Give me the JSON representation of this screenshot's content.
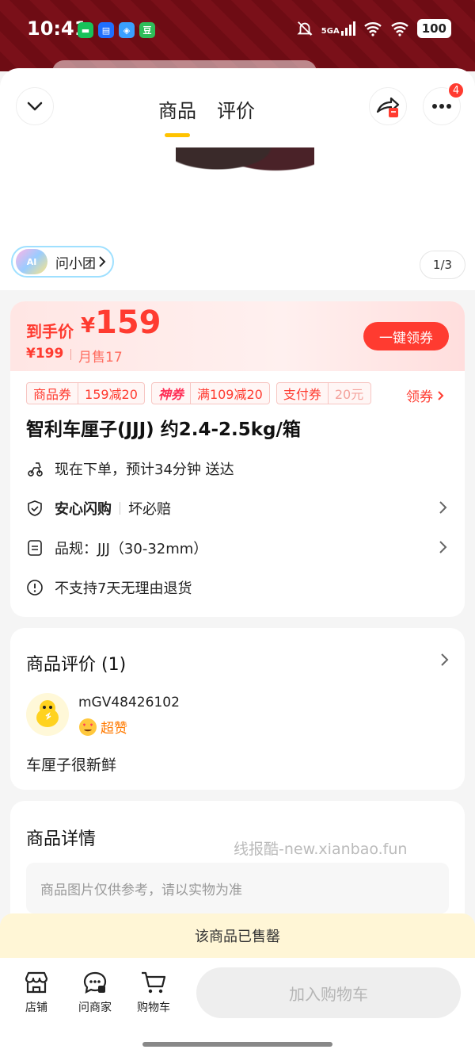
{
  "status_bar": {
    "time": "10:41",
    "network": "5GA",
    "battery": "100",
    "app_icons": [
      {
        "name": "wechat-icon",
        "color": "#17c25a",
        "glyph": ""
      },
      {
        "name": "message-icon",
        "color": "#1f6fff",
        "glyph": ""
      },
      {
        "name": "map-icon",
        "color": "#3aa0ff",
        "glyph": ""
      },
      {
        "name": "douban-icon",
        "color": "#2ebd59",
        "glyph": "豆"
      }
    ]
  },
  "header": {
    "tabs": [
      "商品",
      "评价"
    ],
    "active_tab": "商品",
    "more_badge": "4"
  },
  "hero": {
    "ai_label": "问小团",
    "ai_badge": "AI",
    "page_indicator": "1/3"
  },
  "price": {
    "label": "到手价",
    "currency": "¥",
    "value": "159",
    "original": "¥199",
    "monthly_sales": "月售17",
    "claim_button": "一键领券"
  },
  "coupons": [
    {
      "tag": "商品券",
      "value": "159减20"
    },
    {
      "tag": "神券",
      "value": "满109减20"
    },
    {
      "tag": "支付券",
      "value": "20元"
    }
  ],
  "coupon_more": "领券",
  "product": {
    "title": "智利车厘子(JJJ) 约2.4-2.5kg/箱",
    "delivery": "现在下单，预计34分钟 送达",
    "guarantee_strong": "安心闪购",
    "guarantee_text": "坏必赔",
    "spec": "品规：JJJ（30-32mm）",
    "return_policy": "不支持7天无理由退货"
  },
  "reviews": {
    "title": "商品评价 (1)",
    "user": "mGV48426102",
    "rating_label": "超赞",
    "text": "车厘子很新鲜"
  },
  "details": {
    "title": "商品详情",
    "watermark": "线报酷-new.xianbao.fun",
    "note": "商品图片仅供参考，请以实物为准"
  },
  "sold_out": "该商品已售罄",
  "bottom_bar": {
    "shop": "店铺",
    "ask_merchant": "问商家",
    "cart": "购物车",
    "add_to_cart": "加入购物车"
  },
  "colors": {
    "accent_red": "#ff3b30",
    "tab_indicator": "#ffc300",
    "status_bar_bg": "#6e0c14"
  }
}
